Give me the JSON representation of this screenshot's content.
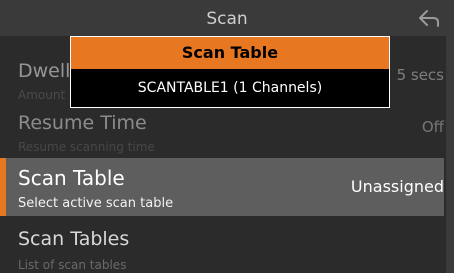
{
  "header": {
    "title": "Scan",
    "back_icon": "back-arrow-icon"
  },
  "menu": {
    "items": [
      {
        "title": "Dwell",
        "subtitle": "Amount",
        "value": "5 secs"
      },
      {
        "title": "Resume Time",
        "subtitle": "Resume scanning time",
        "value": "Off"
      },
      {
        "title": "Scan Table",
        "subtitle": "Select active scan table",
        "value": "Unassigned"
      },
      {
        "title": "Scan Tables",
        "subtitle": "List of scan tables",
        "value": ""
      }
    ]
  },
  "dialog": {
    "title": "Scan Table",
    "options": [
      "SCANTABLE1 (1 Channels)"
    ]
  },
  "colors": {
    "accent": "#e87722",
    "selected_row": "#5e5e5e",
    "background": "#2b2b2b"
  }
}
